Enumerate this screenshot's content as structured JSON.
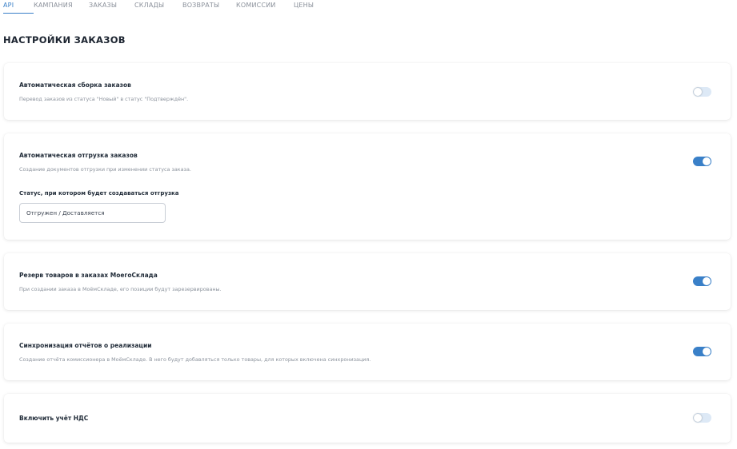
{
  "tabs": [
    {
      "label": "API",
      "active": true
    },
    {
      "label": "КАМПАНИЯ",
      "active": false
    },
    {
      "label": "ЗАКАЗЫ",
      "active": false
    },
    {
      "label": "СКЛАДЫ",
      "active": false
    },
    {
      "label": "ВОЗВРАТЫ",
      "active": false
    },
    {
      "label": "КОМИССИИ",
      "active": false
    },
    {
      "label": "ЦЕНЫ",
      "active": false
    }
  ],
  "page_title": "НАСТРОЙКИ ЗАКАЗОВ",
  "settings": {
    "auto_assembly": {
      "title": "Автоматическая сборка заказов",
      "description": "Перевод заказов из статуса \"Новый\" в статус \"Подтверждён\".",
      "enabled": false
    },
    "auto_shipment": {
      "title": "Автоматическая отгрузка заказов",
      "description": "Создание документов отгрузки при изменении статуса заказа.",
      "enabled": true,
      "status_label": "Статус, при котором будет создаваться отгрузка",
      "status_value": "Отгружен / Доставляется"
    },
    "reserve": {
      "title": "Резерв товаров в заказах МоегоСклада",
      "description": "При создании заказа в МоёмСкладе, его позиции будут зарезервированы.",
      "enabled": true
    },
    "sync_reports": {
      "title": "Синхронизация отчётов о реализации",
      "description": "Создание отчёта комиссионера в МоёмСкладе. В него будут добавляться только товары, для которых включена синхронизация.",
      "enabled": true
    },
    "vat": {
      "title": "Включить учёт НДС",
      "enabled": false
    }
  },
  "colors": {
    "accent": "#3a80c8",
    "toggle_off": "#dde9f6"
  }
}
